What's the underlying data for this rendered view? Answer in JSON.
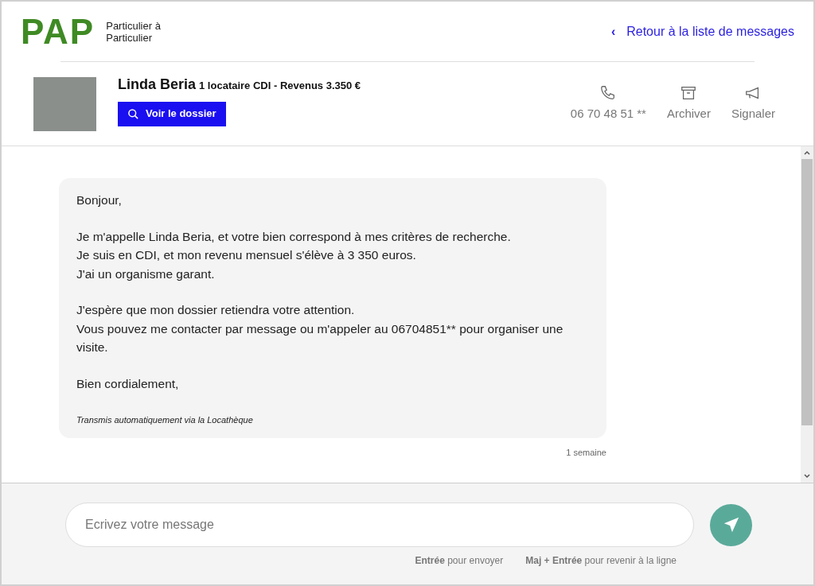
{
  "logo": {
    "mark": "PAP",
    "tagline": [
      "Particulier à",
      "Particulier"
    ]
  },
  "back_link": {
    "icon": "‹",
    "label": "Retour à la liste de messages"
  },
  "contact": {
    "name": "Linda Beria",
    "summary": "1 locataire CDI - Revenus 3.350 €",
    "button": "Voir le dossier"
  },
  "actions": [
    {
      "kind": "phone",
      "label": "06 70 48 51 **"
    },
    {
      "kind": "archive",
      "label": "Archiver"
    },
    {
      "kind": "report",
      "label": "Signaler"
    }
  ],
  "message": {
    "paragraphs": [
      [
        "Bonjour,"
      ],
      [
        "Je m'appelle Linda Beria, et votre bien correspond à mes critères de recherche.",
        "Je suis en CDI, et mon revenu mensuel s'élève à 3 350 euros.",
        "J'ai un organisme garant."
      ],
      [
        "J'espère que mon dossier retiendra votre attention.",
        "Vous pouvez me contacter par message ou m'appeler au 06704851** pour organiser une visite."
      ],
      [
        "Bien cordialement,"
      ]
    ],
    "footer": "Transmis automatiquement via la Locathèque",
    "time": "1 semaine"
  },
  "composer": {
    "placeholder": "Ecrivez votre message",
    "hints": [
      "**Entrée** pour envoyer",
      "**Maj + Entrée** pour revenir à la ligne"
    ]
  }
}
